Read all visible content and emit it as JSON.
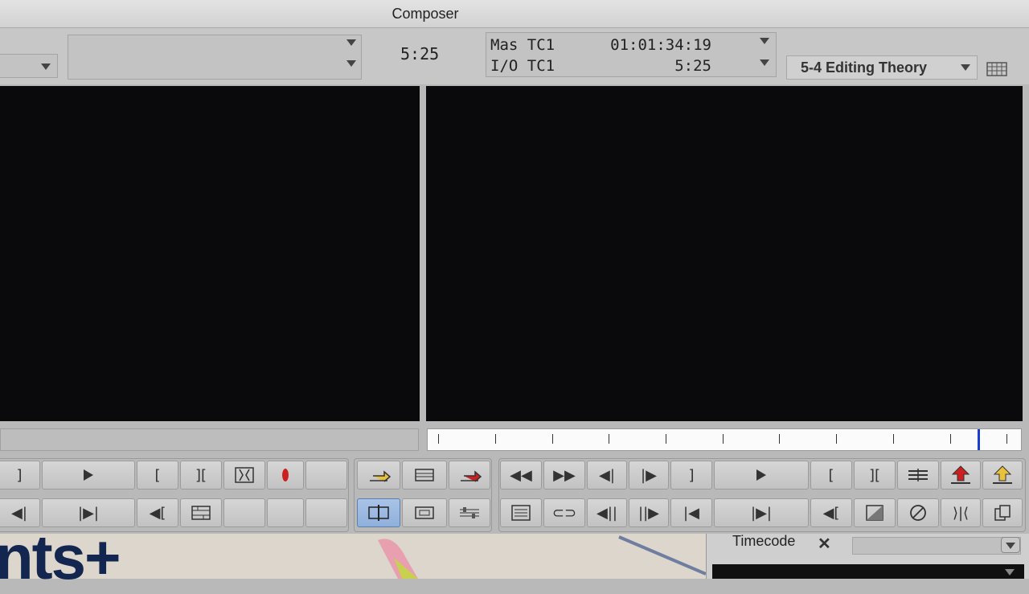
{
  "window": {
    "title": "Composer"
  },
  "header": {
    "source_timecode": "5:25",
    "tracks": [
      {
        "label": "Mas TC1",
        "value": "01:01:34:19"
      },
      {
        "label": "I/O TC1",
        "value": "5:25"
      }
    ],
    "project_button": "5-4 Editing Theory"
  },
  "timecode_panel": {
    "title": "Timecode",
    "close": "✕"
  },
  "background": {
    "partial_text": "nts+"
  },
  "colors": {
    "monitor_bg": "#0a0a0c",
    "playhead": "#1a3fd0",
    "selected_button": "#9ab7e0",
    "mark_red": "#cc2020",
    "arrow_yellow": "#e8c23a"
  },
  "icons": {
    "source_row1": [
      "mark-out-icon",
      "play-icon",
      "mark-in-icon",
      "clear-marks-icon",
      "mark-clip-icon",
      "record-icon",
      "blank"
    ],
    "center_row1": [
      "splice-in-icon",
      "sync-lock-icon",
      "overwrite-icon"
    ],
    "record_row1": [
      "rewind-icon",
      "fast-forward-icon",
      "step-back-icon",
      "step-forward-icon",
      "mark-out-icon",
      "play-icon",
      "mark-in-icon",
      "clear-marks-icon",
      "add-edit-icon",
      "lift-icon",
      "extract-icon"
    ],
    "source_row2": [
      "go-to-in-icon",
      "go-to-out-icon",
      "play-in-to-out-icon",
      "match-frame-icon",
      "blank",
      "blank"
    ],
    "center_row2": [
      "toggle-source-record-icon",
      "clip-name-icon",
      "audio-mixer-icon"
    ],
    "record_row2": [
      "bin-list-icon",
      "link-icon",
      "step-back-frame-icon",
      "step-forward-frame-icon",
      "go-to-prev-edit-icon",
      "go-to-out-icon",
      "play-in-to-out-icon",
      "effect-icon",
      "no-effect-icon",
      "trim-icon",
      "copy-icon"
    ]
  }
}
